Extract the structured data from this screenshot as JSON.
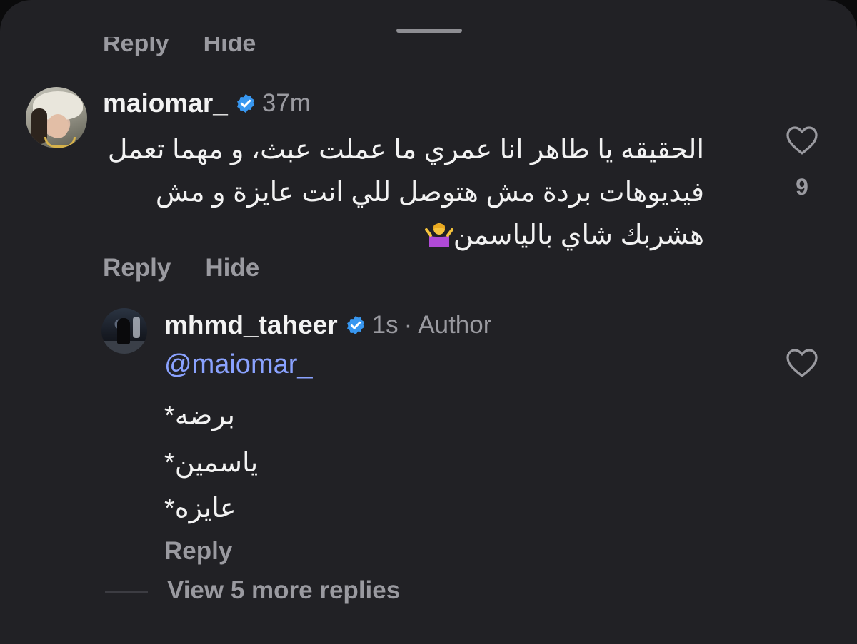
{
  "cutoff_actions": {
    "reply": "Reply",
    "hide": "Hide"
  },
  "comments": [
    {
      "username": "maiomar_",
      "time": "37m",
      "verified": true,
      "text": "الحقيقه يا طاهر انا عمري ما عملت عبث، و مهما تعمل فيديوهات بردة مش هتوصل للي انت عايزة و مش هشربك شاي بالياسمن",
      "emoji": "person-shrugging",
      "likes": "9",
      "actions": {
        "reply": "Reply",
        "hide": "Hide"
      },
      "avatar_icon": "profile-photo"
    },
    {
      "username": "mhmd_taheer",
      "time": "1s",
      "separator": "·",
      "badge": "Author",
      "verified": true,
      "mention": "@maiomar_",
      "lines": [
        "برضه*",
        "ياسمين*",
        "عايزه*"
      ],
      "actions": {
        "reply": "Reply"
      },
      "avatar_icon": "profile-photo"
    }
  ],
  "view_more": "View 5 more replies",
  "colors": {
    "sheet": "#212125",
    "text": "#f2f2f2",
    "muted": "#9a9aa0",
    "mention": "#8aa2ff",
    "verified": "#3897f0"
  }
}
